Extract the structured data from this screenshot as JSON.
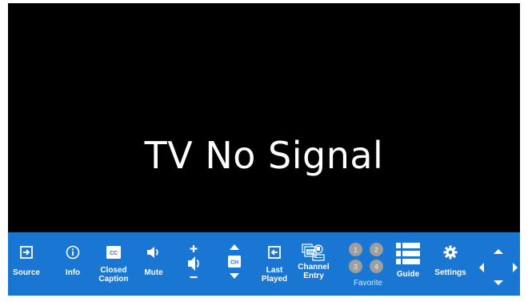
{
  "screen": {
    "status": "TV No Signal",
    "background": "#000000"
  },
  "control_bar": {
    "background": "#1976d2",
    "source": {
      "label": "Source",
      "icon": "input-icon"
    },
    "info": {
      "label": "Info",
      "icon": "info-icon"
    },
    "closed_caption": {
      "label": "Closed\nCaption",
      "icon": "cc-icon"
    },
    "mute": {
      "label": "Mute",
      "icon": "volume-icon"
    },
    "volume": {
      "icon": "volume-icon"
    },
    "channel": {
      "badge": "CH",
      "icon": "channel-icon"
    },
    "last_played": {
      "label": "Last\nPlayed",
      "icon": "return-icon"
    },
    "channel_entry": {
      "label": "Channel\nEntry",
      "icon": "channel-entry-icon"
    },
    "favorite": {
      "label": "Favorite",
      "slots": [
        "1",
        "2",
        "3",
        "4"
      ],
      "slot_color": "#9e9e9e"
    },
    "guide": {
      "label": "Guide",
      "icon": "list-icon"
    },
    "settings": {
      "label": "Settings",
      "icon": "gear-icon"
    },
    "dpad": {
      "icon": "dpad-icon"
    }
  }
}
